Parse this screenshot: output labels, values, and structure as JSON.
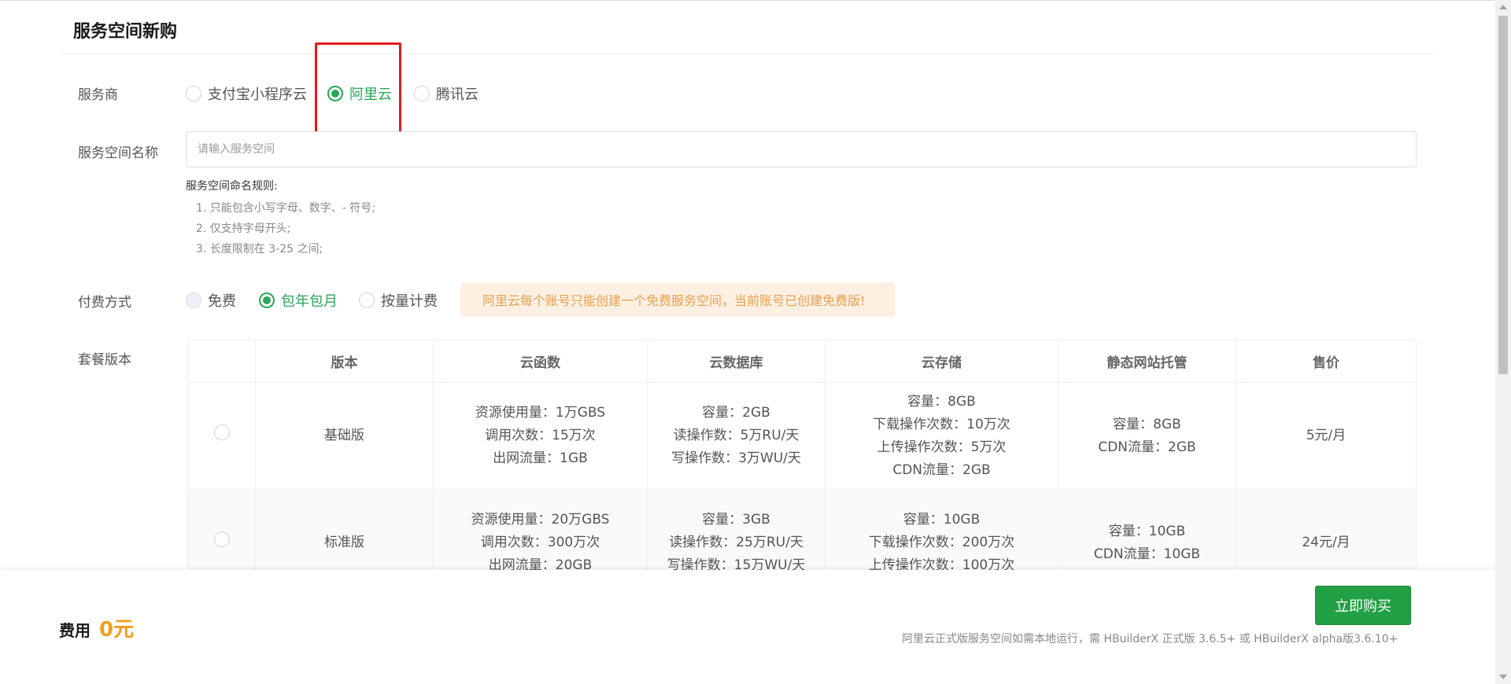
{
  "page": {
    "title": "服务空间新购"
  },
  "provider": {
    "label": "服务商",
    "options": [
      "支付宝小程序云",
      "阿里云",
      "腾讯云"
    ],
    "selected": "阿里云"
  },
  "space_name": {
    "label": "服务空间名称",
    "placeholder": "请输入服务空间",
    "value": "",
    "rules_title": "服务空间命名规则:",
    "rules": [
      "1. 只能包含小写字母、数字、- 符号;",
      "2. 仅支持字母开头;",
      "3. 长度限制在 3-25 之间;"
    ]
  },
  "payment": {
    "label": "付费方式",
    "options": [
      "免费",
      "包年包月",
      "按量计费"
    ],
    "selected": "包年包月",
    "disabled": "免费",
    "notice": "阿里云每个账号只能创建一个免费服务空间，当前账号已创建免费版!"
  },
  "plans": {
    "label": "套餐版本",
    "headers": [
      "",
      "版本",
      "云函数",
      "云数据库",
      "云存储",
      "静态网站托管",
      "售价"
    ],
    "rows": [
      {
        "name": "基础版",
        "functions": [
          "资源使用量：1万GBS",
          "调用次数：15万次",
          "出网流量：1GB"
        ],
        "database": [
          "容量：2GB",
          "读操作数：5万RU/天",
          "写操作数：3万WU/天"
        ],
        "storage": [
          "容量：8GB",
          "下载操作次数：10万次",
          "上传操作次数：5万次",
          "CDN流量：2GB"
        ],
        "hosting": [
          "容量：8GB",
          "CDN流量：2GB"
        ],
        "price": "5元/月"
      },
      {
        "name": "标准版",
        "functions": [
          "资源使用量：20万GBS",
          "调用次数：300万次",
          "出网流量：20GB"
        ],
        "database": [
          "容量：3GB",
          "读操作数：25万RU/天",
          "写操作数：15万WU/天"
        ],
        "storage": [
          "容量：10GB",
          "下载操作次数：200万次",
          "上传操作次数：100万次"
        ],
        "hosting": [
          "容量：10GB",
          "CDN流量：10GB"
        ],
        "price": "24元/月"
      }
    ]
  },
  "footer": {
    "fee_label": "费用",
    "fee_value": "0元",
    "buy_label": "立即购买",
    "note": "阿里云正式版服务空间如需本地运行，需 HBuilderX 正式版 3.6.5+ 或 HBuilderX alpha版3.6.10+"
  },
  "colors": {
    "accent": "#2aa65c",
    "warning": "#e8a04c",
    "price": "#f0a020",
    "buy_button": "#22a045",
    "highlight": "#e11b1b"
  }
}
